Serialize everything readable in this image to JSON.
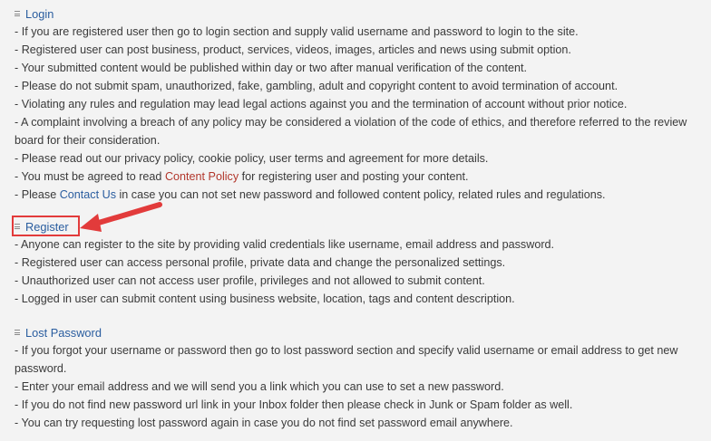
{
  "login": {
    "title": "Login",
    "lines": [
      "- If you are registered user then go to login section and supply valid username and password to login to the site.",
      "- Registered user can post business, product, services, videos, images, articles and news using submit option.",
      "- Your submitted content would be published within day or two after manual verification of the content.",
      "- Please do not submit spam, unauthorized, fake, gambling, adult and copyright content to avoid termination of account.",
      "- Violating any rules and regulation may lead legal actions against you and the termination of account without prior notice.",
      "- A complaint involving a breach of any policy may be considered a violation of the code of ethics, and therefore referred to the review board for their consideration.",
      "- Please read out our privacy policy, cookie policy, user terms and agreement for more details."
    ],
    "content_policy_pre": "- You must be agreed to read ",
    "content_policy_link": "Content Policy",
    "content_policy_post": " for registering user and posting your content.",
    "contact_pre": "- Please ",
    "contact_link": "Contact Us",
    "contact_post": " in case you can not set new password and followed content policy, related rules and regulations."
  },
  "register": {
    "title": "Register",
    "lines": [
      "- Anyone can register to the site by providing valid credentials like username, email address and password.",
      "- Registered user can access personal profile, private data and change the personalized settings.",
      "- Unauthorized user can not access user profile, privileges and not allowed to submit content.",
      "- Logged in user can submit content using business website, location, tags and content description."
    ]
  },
  "lost_password": {
    "title": "Lost Password",
    "lines": [
      "- If you forgot your username or password then go to lost password section and specify valid username or email address to get new password.",
      "- Enter your email address and we will send you a link which you can use to set a new password.",
      "- If you do not find new password url link in your Inbox folder then please check in Junk or Spam folder as well.",
      "- You can try requesting lost password again in case you do not find set password email anywhere."
    ]
  },
  "colors": {
    "link_blue": "#2a5d9f",
    "link_red": "#b2372c",
    "highlight_red": "#e23b3b"
  }
}
